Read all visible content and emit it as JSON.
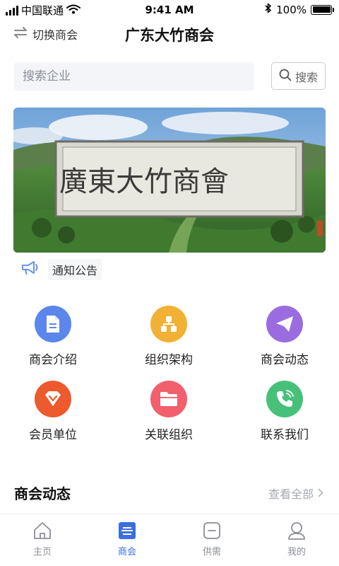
{
  "status_bar": {
    "carrier": "中国联通",
    "time": "9:41 AM",
    "battery": "100%",
    "battery_level": 1.0
  },
  "header": {
    "switch_label": "切换商会",
    "title": "广东大竹商会"
  },
  "search": {
    "placeholder": "搜索企业",
    "value": "",
    "button_label": "搜索"
  },
  "banner": {
    "calligraphy": "廣東大竹商會"
  },
  "notice": {
    "label": "通知公告"
  },
  "grid": {
    "items": [
      {
        "label": "商会介绍",
        "icon": "document-icon",
        "color": "#5b86ec"
      },
      {
        "label": "组织架构",
        "icon": "org-structure-icon",
        "color": "#f2b134"
      },
      {
        "label": "商会动态",
        "icon": "paper-plane-icon",
        "color": "#9b6ce0"
      },
      {
        "label": "会员单位",
        "icon": "diamond-icon",
        "color": "#ec5a2d"
      },
      {
        "label": "关联组织",
        "icon": "folder-icon",
        "color": "#f25f6d"
      },
      {
        "label": "联系我们",
        "icon": "phone-icon",
        "color": "#47c07a"
      }
    ]
  },
  "section": {
    "title": "商会动态",
    "view_all": "查看全部"
  },
  "tabs": [
    {
      "label": "主页",
      "icon": "home-icon",
      "active": false
    },
    {
      "label": "商会",
      "icon": "chamber-icon",
      "active": true
    },
    {
      "label": "供需",
      "icon": "supply-demand-icon",
      "active": false
    },
    {
      "label": "我的",
      "icon": "profile-icon",
      "active": false
    }
  ],
  "colors": {
    "accent": "#3b6fe0",
    "inactive": "#8c8f96"
  }
}
